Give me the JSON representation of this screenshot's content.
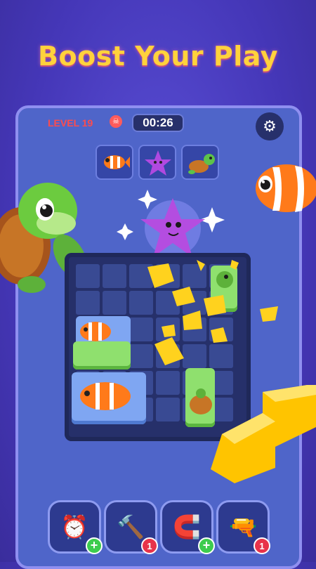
{
  "headline": "Boost Your Play",
  "hud": {
    "level": "LEVEL 19",
    "timer": "00:26",
    "skull_icon": "skull-icon",
    "settings_icon": "gear-icon"
  },
  "goals": [
    {
      "name": "clownfish",
      "icon": "clownfish-icon"
    },
    {
      "name": "starfish",
      "icon": "starfish-icon"
    },
    {
      "name": "turtle",
      "icon": "turtle-icon"
    }
  ],
  "boosters": [
    {
      "name": "freeze-timer",
      "icon": "clock-freeze-icon",
      "badge": "+"
    },
    {
      "name": "hammer",
      "icon": "hammer-icon",
      "badge": "1"
    },
    {
      "name": "magnet",
      "icon": "magnet-icon",
      "badge": "+"
    },
    {
      "name": "blaster",
      "icon": "raygun-icon",
      "badge": "1"
    }
  ],
  "colors": {
    "background": "#4537b8",
    "headline": "#ffd23c",
    "level_text": "#ff4c4c",
    "block_green": "#8fe06e",
    "block_blue": "#7fa6f2",
    "block_yellow": "#ffd21e"
  }
}
